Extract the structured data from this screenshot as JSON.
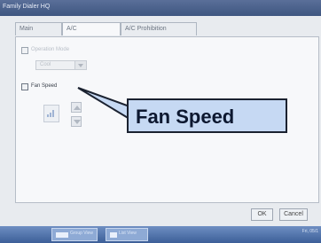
{
  "window": {
    "title": "Family  Dialer HQ"
  },
  "tabs": [
    {
      "label": "Main"
    },
    {
      "label": "A/C"
    },
    {
      "label": "A/C Prohibition"
    }
  ],
  "operation_mode": {
    "label": "Operation Mode",
    "value": "Cool"
  },
  "fan_speed": {
    "label": "Fan Speed"
  },
  "buttons": {
    "ok": "OK",
    "cancel": "Cancel"
  },
  "taskbar": {
    "btn1": "Group View",
    "btn2": "List View",
    "clock": "Fri, 05/1"
  },
  "callout": {
    "text": "Fan Speed"
  },
  "colors": {
    "accent": "#3e5680",
    "callout_fill": "#c6d9f3"
  }
}
